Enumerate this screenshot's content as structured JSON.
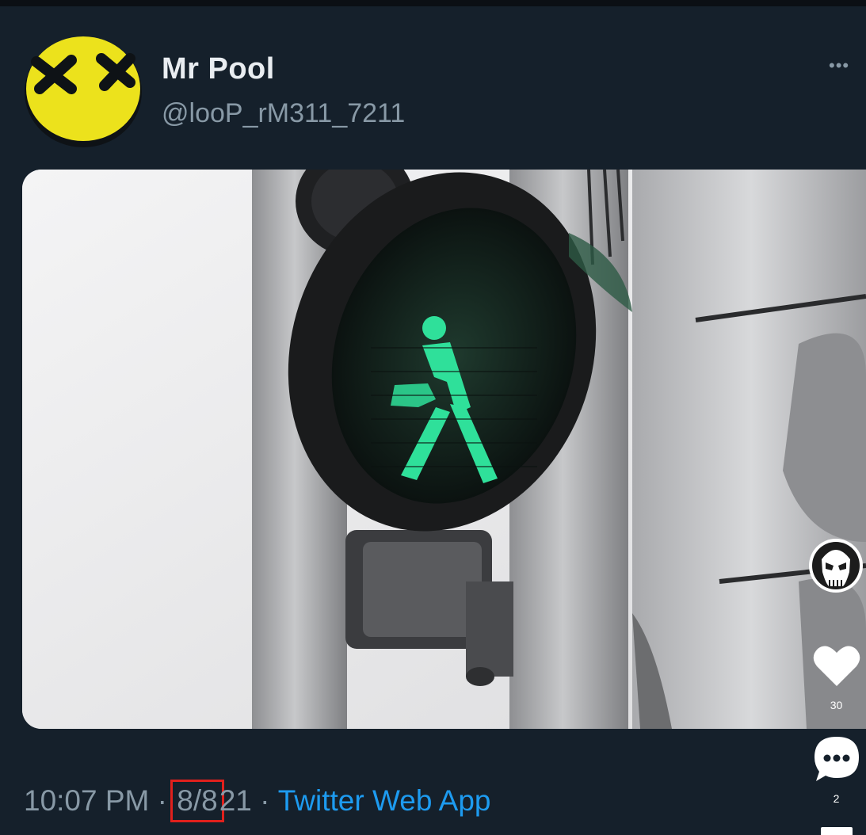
{
  "tweet": {
    "display_name": "Mr Pool",
    "handle": "@looP_rM311_7211",
    "more_icon": "ellipsis-icon",
    "time": "10:07 PM",
    "sep1": "·",
    "date_highlighted": "8/8",
    "date_rest": "21",
    "sep2": "·",
    "source": "Twitter Web App",
    "colors": {
      "background": "#15202b",
      "secondary_text": "#8899a6",
      "link": "#1d9bf0",
      "highlight_box": "#e0201c",
      "walk_signal": "#2fe09a"
    }
  },
  "side_rail": {
    "avatar_icon": "skull-icon",
    "like_icon": "heart-icon",
    "like_count": "30",
    "comment_icon": "comment-bubble-icon",
    "comment_count": "2",
    "share_icon": "share-icon"
  }
}
